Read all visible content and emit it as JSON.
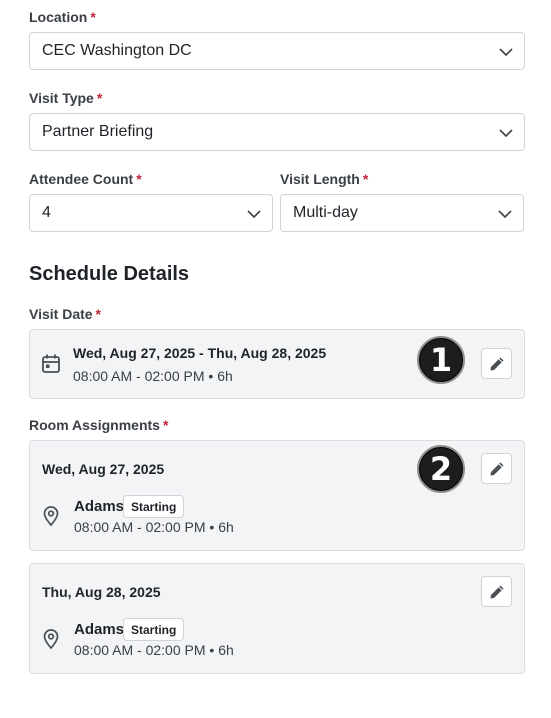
{
  "form": {
    "location": {
      "label": "Location",
      "required_mark": "*",
      "value": "CEC Washington DC"
    },
    "visit_type": {
      "label": "Visit Type",
      "required_mark": "*",
      "value": "Partner Briefing"
    },
    "attendee_count": {
      "label": "Attendee Count",
      "required_mark": "*",
      "value": "4"
    },
    "visit_length": {
      "label": "Visit Length",
      "required_mark": "*",
      "value": "Multi-day"
    }
  },
  "schedule": {
    "title": "Schedule Details",
    "visit_date": {
      "label": "Visit Date",
      "required_mark": "*",
      "range": "Wed, Aug 27, 2025 - Thu, Aug 28, 2025",
      "time": "08:00 AM - 02:00 PM • 6h",
      "icon": "calendar-icon",
      "marker": "1"
    },
    "room_assignments": {
      "label": "Room Assignments",
      "required_mark": "*",
      "days": [
        {
          "date": "Wed, Aug 27, 2025",
          "room": "Adams",
          "badge": "Starting",
          "time": "08:00 AM - 02:00 PM • 6h",
          "icon": "location-pin-icon",
          "marker": "2"
        },
        {
          "date": "Thu, Aug 28, 2025",
          "room": "Adams",
          "badge": "Starting",
          "time": "08:00 AM - 02:00 PM • 6h",
          "icon": "location-pin-icon"
        }
      ]
    }
  },
  "colors": {
    "required": "#c0263a",
    "card_bg": "#f3f4f5",
    "border": "#cfd3d8",
    "marker_bg": "#1d1d1d"
  }
}
